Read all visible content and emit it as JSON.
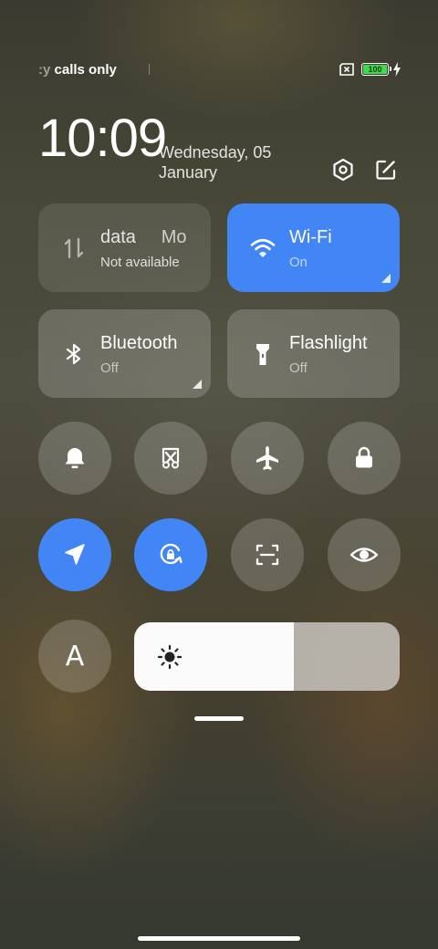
{
  "status_bar": {
    "carrier_text_faded": ":y",
    "carrier_text": " calls only",
    "battery_level": "100",
    "battery_fraction": 1.0,
    "icons": [
      "sim-no-service-icon",
      "battery-icon",
      "charging-bolt-icon"
    ],
    "battery_color": "#3ddc4e"
  },
  "header": {
    "time": "10:09",
    "date_line1": "Wednesday, 05",
    "date_line2": "January",
    "icons": [
      "settings-icon",
      "edit-icon"
    ]
  },
  "tiles": {
    "mobile_data": {
      "title": "data",
      "title_clip": "Mo",
      "status": "Not available",
      "icon": "mobile-data-icon"
    },
    "wifi": {
      "title": "Wi-Fi",
      "status": "On",
      "icon": "wifi-icon"
    },
    "bluetooth": {
      "title": "Bluetooth",
      "status": "Off",
      "icon": "bluetooth-icon"
    },
    "flashlight": {
      "title": "Flashlight",
      "status": "Off",
      "icon": "flashlight-icon"
    }
  },
  "toggles_row1": [
    "bell-icon",
    "screenshot-icon",
    "airplane-icon",
    "lock-icon"
  ],
  "toggles_row2": [
    "location-icon",
    "rotation-lock-icon",
    "scan-icon",
    "eye-icon"
  ],
  "auto_brightness_label": "A",
  "brightness": {
    "level": 0.6,
    "icon": "sun-icon"
  },
  "colors": {
    "accent": "#4285f4",
    "tile_off": "rgba(255,255,255,0.18)"
  }
}
